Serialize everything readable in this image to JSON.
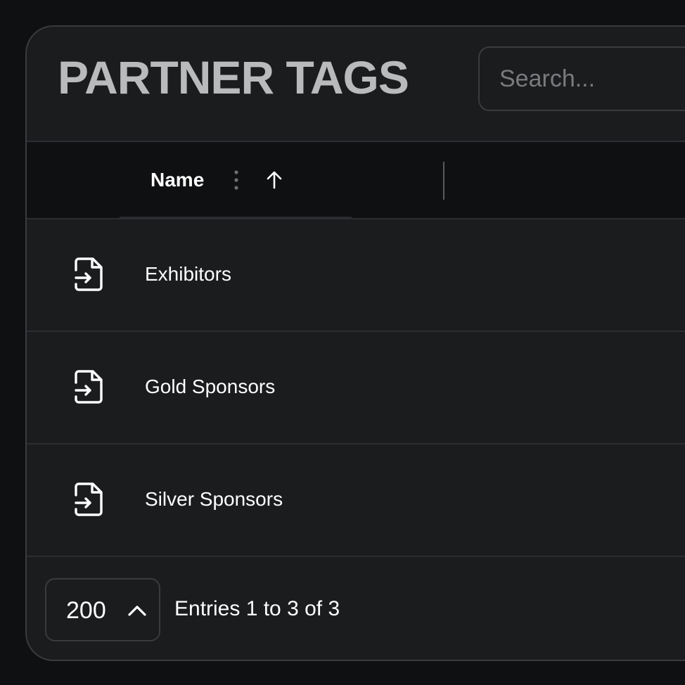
{
  "header": {
    "title": "PARTNER TAGS",
    "search_placeholder": "Search..."
  },
  "table": {
    "columns": [
      {
        "label": "Name",
        "sort": "ascending"
      }
    ],
    "rows": [
      {
        "label": "Exhibitors",
        "icon": "file-import-icon"
      },
      {
        "label": "Gold Sponsors",
        "icon": "file-import-icon"
      },
      {
        "label": "Silver Sponsors",
        "icon": "file-import-icon"
      }
    ]
  },
  "footer": {
    "page_size": "200",
    "entries_text": "Entries 1 to 3 of 3"
  },
  "colors": {
    "background": "#0f1012",
    "panel": "#1b1c1e",
    "title": "#b9babc",
    "text": "#ffffff"
  }
}
